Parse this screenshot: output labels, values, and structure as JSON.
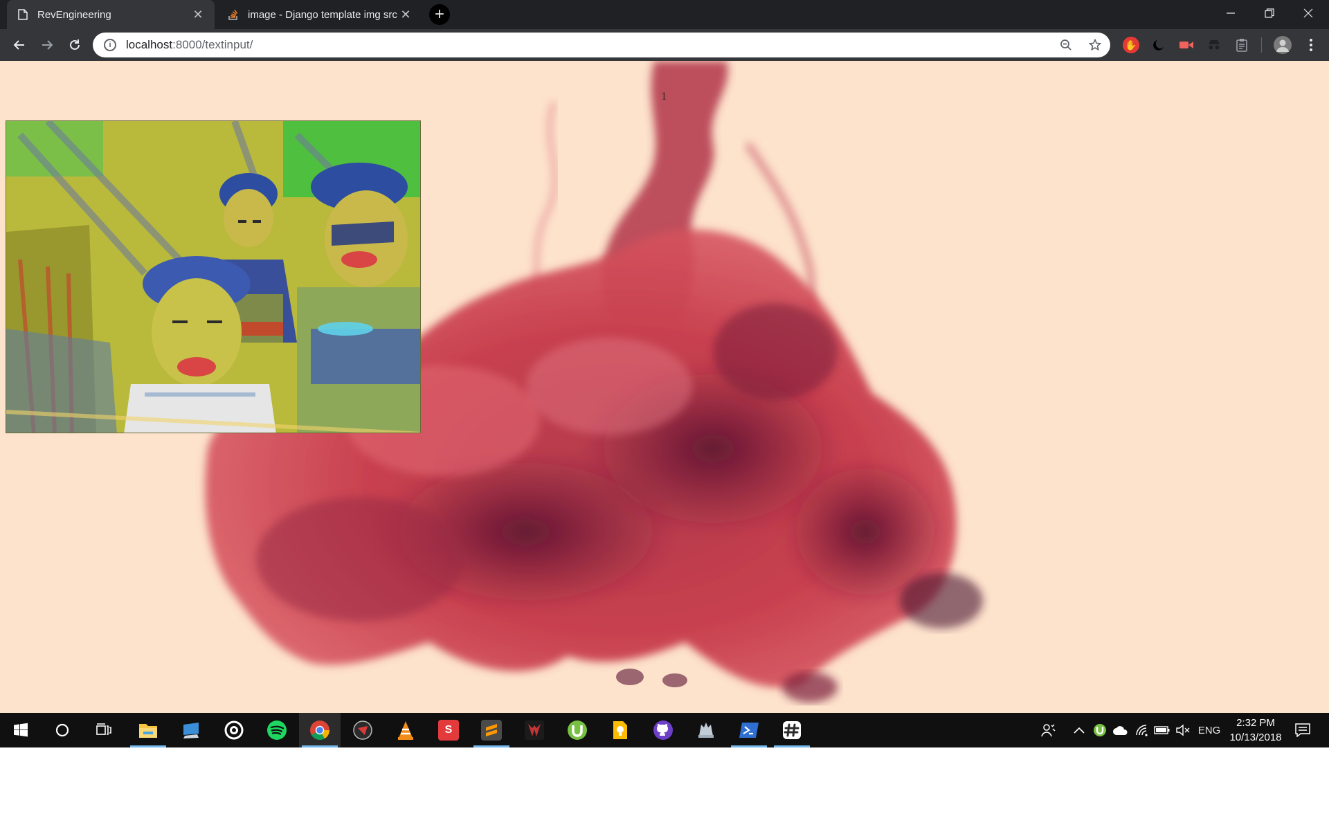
{
  "browser": {
    "tabs": [
      {
        "title": "RevEngineering",
        "active": true
      },
      {
        "title": "image - Django template img src",
        "active": false
      }
    ],
    "new_tab_label": "+",
    "close_glyph": "✕",
    "url_host": "localhost",
    "url_rest": ":8000/textinput/",
    "icons": {
      "back": "arrow-left",
      "forward": "arrow-right",
      "reload": "reload",
      "info": "info",
      "zoom": "zoom-out",
      "bookmark": "star",
      "menu": "kebab"
    },
    "extensions": [
      "ublock",
      "dark-mode",
      "screen-recorder",
      "incognito-extension",
      "clipboard",
      "profile-avatar"
    ]
  },
  "page": {
    "marker_text": "1",
    "background": "#fde2cc",
    "smoke_color": "#c8404f"
  },
  "taskbar": {
    "apps": [
      "start",
      "cortana",
      "task-view",
      "file-explorer",
      "remote-desktop",
      "groove",
      "spotify",
      "chrome",
      "vpn",
      "vlc",
      "wps",
      "sublime-text",
      "predator",
      "utorrent",
      "keep",
      "github",
      "cloud-app",
      "powershell",
      "slack"
    ],
    "language": "ENG",
    "time": "2:32 PM",
    "date": "10/13/2018"
  }
}
